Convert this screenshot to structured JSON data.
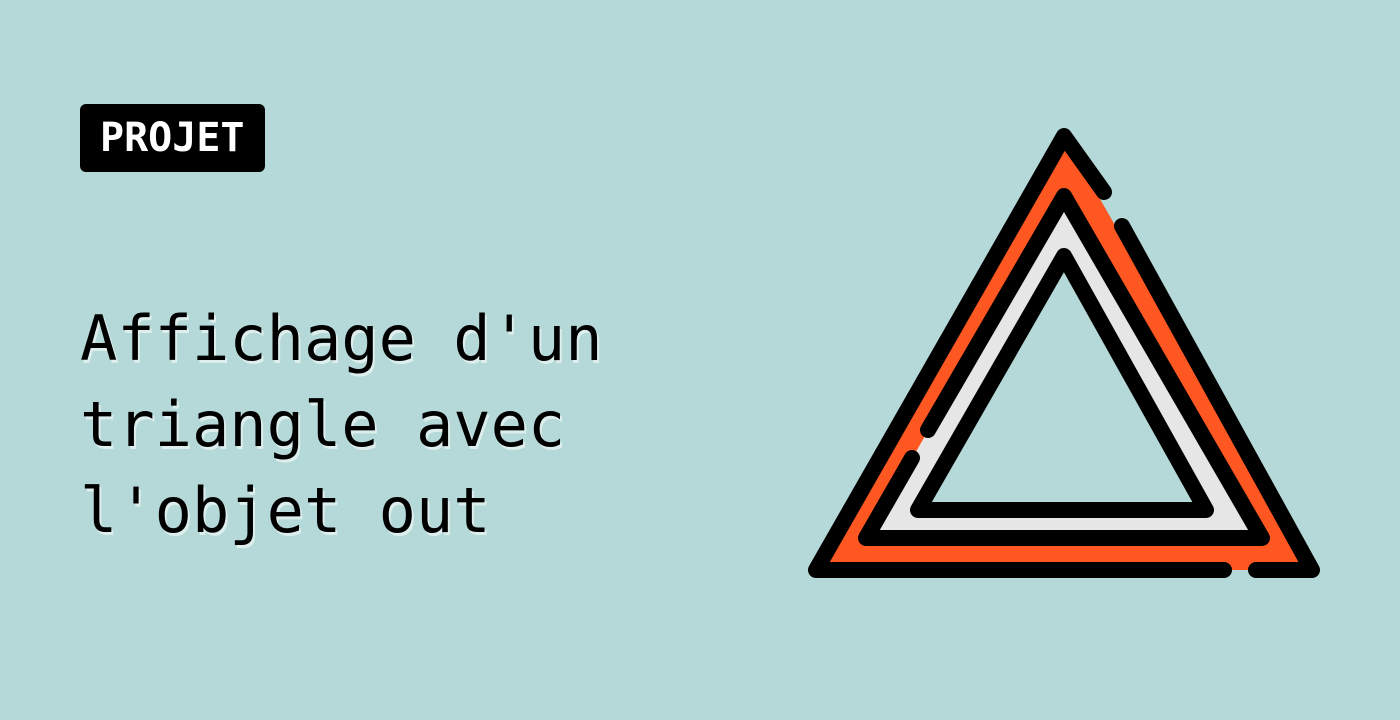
{
  "badge": {
    "label": "PROJET"
  },
  "title": {
    "lines": [
      "Affichage d'un",
      "triangle avec",
      "l'objet out"
    ]
  },
  "illustration": {
    "icon": "warning-triangle-icon",
    "colors": {
      "background": "#b5d9d8",
      "outline": "#000000",
      "outer_fill": "#ff5722",
      "inner_band": "#e6e6e6"
    }
  }
}
